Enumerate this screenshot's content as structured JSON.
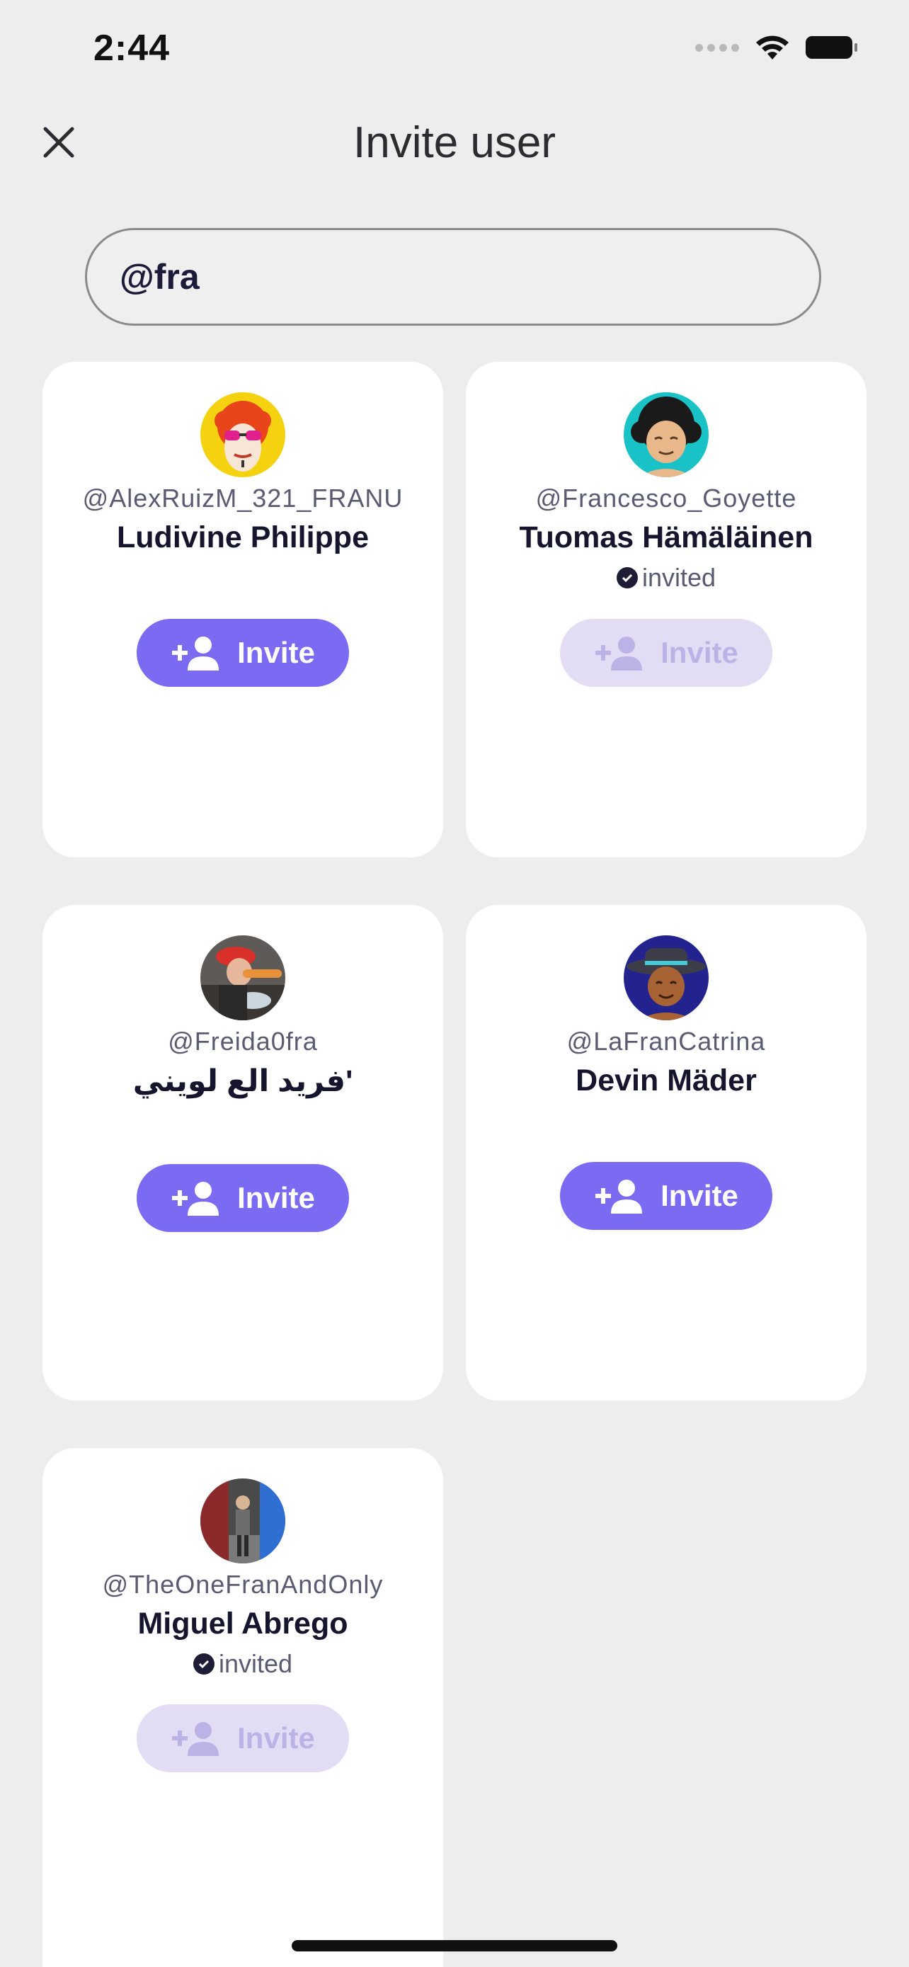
{
  "status_bar": {
    "time": "2:44"
  },
  "header": {
    "title": "Invite user",
    "close_icon": "close-icon"
  },
  "search": {
    "value": "@fra",
    "placeholder": ""
  },
  "users": [
    {
      "username": "@AlexRuizM_321_FRANU",
      "name": "Ludivine Philippe",
      "invited": false,
      "invite_label": "Invite"
    },
    {
      "username": "@Francesco_Goyette",
      "name": "Tuomas Hämäläinen",
      "invited": true,
      "invited_label": "invited",
      "invite_label": "Invite"
    },
    {
      "username": "@Freida0fra",
      "name": "فريد الع لويني'",
      "invited": false,
      "invite_label": "Invite"
    },
    {
      "username": "@LaFranCatrina",
      "name": "Devin Mäder",
      "invited": false,
      "invite_label": "Invite"
    },
    {
      "username": "@TheOneFranAndOnly",
      "name": "Miguel Abrego",
      "invited": true,
      "invited_label": "invited",
      "invite_label": "Invite"
    }
  ],
  "colors": {
    "accent": "#7b6af2",
    "accent_disabled": "#e2ddf4",
    "background": "#ededed",
    "card": "#ffffff"
  }
}
